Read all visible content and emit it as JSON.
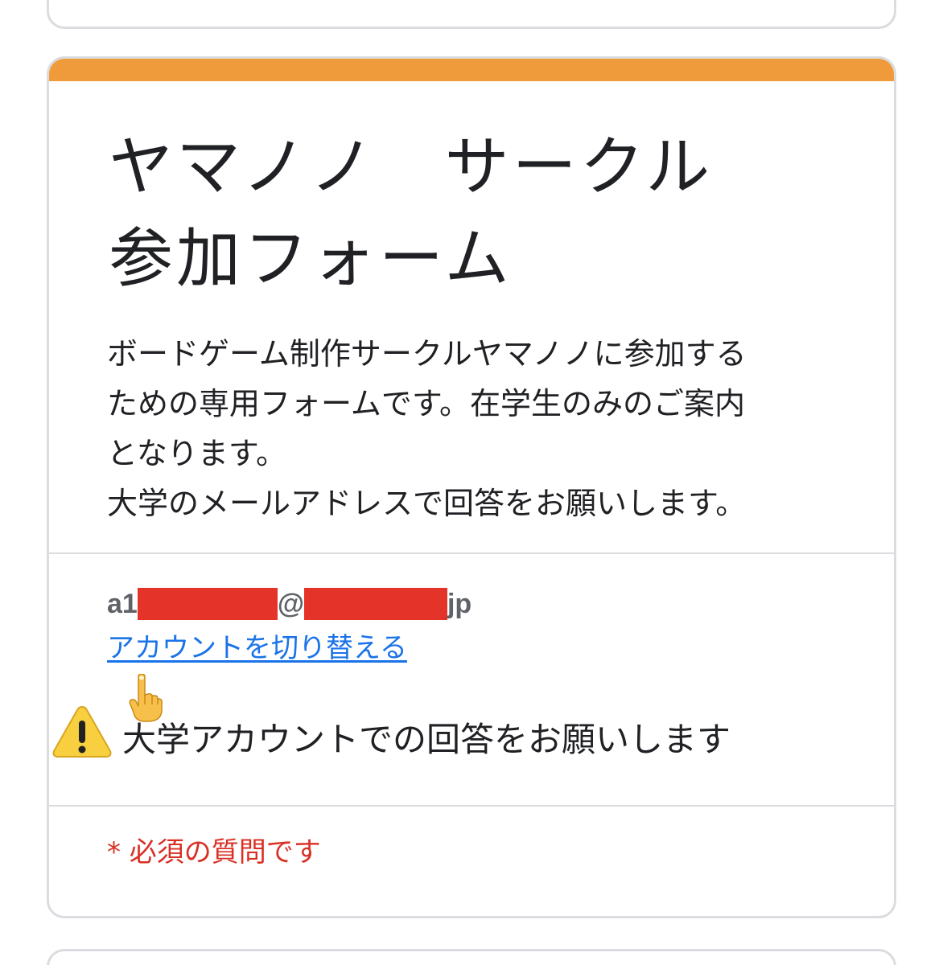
{
  "form": {
    "title": "ヤマノノ　サークル\n参加フォーム",
    "accent_color": "#f09b3b",
    "description_lines": [
      "ボードゲーム制作サークルヤマノノに参加する",
      "ための専用フォームです。在学生のみのご案内",
      "となります。",
      "大学のメールアドレスで回答をお願いします。"
    ]
  },
  "account": {
    "email_prefix": "a1",
    "email_at": "@",
    "email_suffix": "jp",
    "redaction_color": "#e4342a",
    "switch_account_label": "アカウントを切り替える"
  },
  "annotation": {
    "pointer_icon": "pointing-up-hand-icon",
    "warning_icon": "warning-icon",
    "warning_text": "大学アカウントでの回答をお願いします"
  },
  "required_note": "* 必須の質問です"
}
